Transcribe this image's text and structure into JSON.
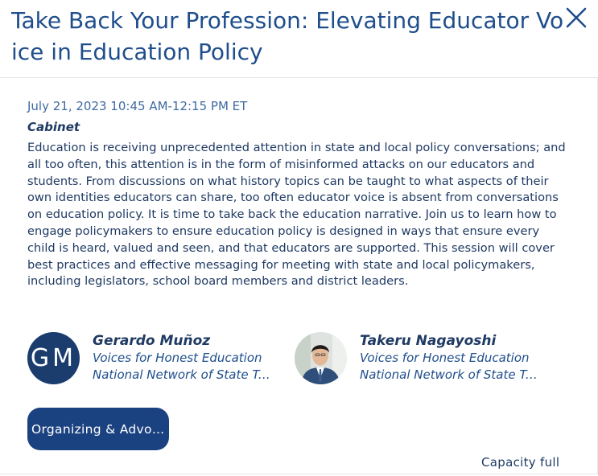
{
  "modal": {
    "title": "Take Back Your Profession: Elevating Educator Voice in Education Policy",
    "close_icon": "close-icon"
  },
  "session": {
    "datetime": "July 21, 2023 10:45 AM-12:15 PM ET",
    "location": "Cabinet",
    "description": "Education is receiving unprecedented attention in state and local policy conversations; and all too often, this attention is in the form of misinformed attacks on our educators and students. From discussions on what history topics can be taught to what aspects of their own identities educators can share, too often educator voice is absent from conversations on education policy. It is time to take back the education narrative. Join us to learn how to engage policymakers to ensure education policy is designed in ways that ensure every child is heard, valued and seen, and that educators are supported. This session will cover best practices and effective messaging for meeting with state and local policymakers, including legislators, school board members and district leaders."
  },
  "speakers": [
    {
      "initials": "GM",
      "name": "Gerardo Muñoz",
      "org1": "Voices for Honest Education",
      "org2": "National Network of State Teachers of the Year"
    },
    {
      "initials": "",
      "name": "Takeru Nagayoshi",
      "org1": "Voices for Honest Education",
      "org2": "National Network of State Teachers of the Year"
    }
  ],
  "tag": {
    "label": "Organizing & Advocacy"
  },
  "status": {
    "capacity": "Capacity full"
  },
  "colors": {
    "primary": "#1b4280",
    "text": "#1f3a63",
    "accent": "#1f4e8c"
  }
}
